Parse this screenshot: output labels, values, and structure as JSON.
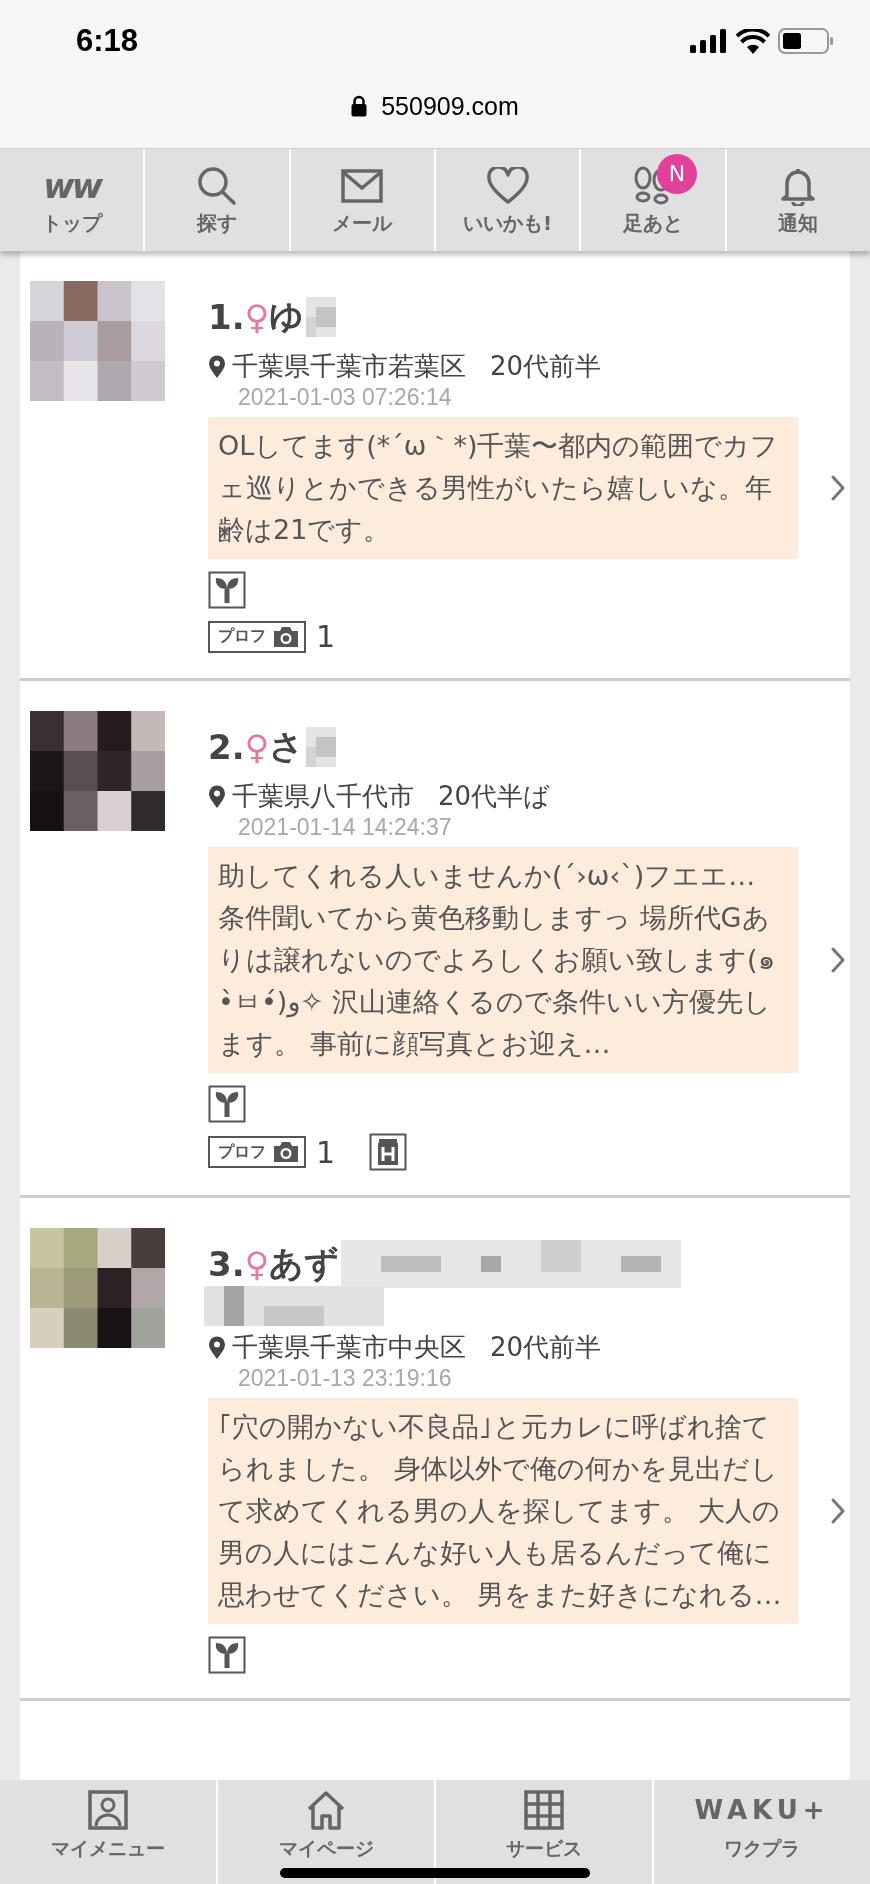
{
  "status_bar": {
    "time": "6:18"
  },
  "browser": {
    "url": "550909.com"
  },
  "nav_tabs": [
    {
      "logo": "ww",
      "label": "トップ"
    },
    {
      "label": "探す"
    },
    {
      "label": "メール"
    },
    {
      "label": "いいかも!"
    },
    {
      "label": "足あと",
      "badge": "N"
    },
    {
      "label": "通知"
    }
  ],
  "posts": [
    {
      "rank": "1.",
      "gender": "♀",
      "name": "ゆ",
      "kind": "short",
      "location": "千葉県千葉市若葉区",
      "age": "20代前半",
      "date": "2021-01-03 07:26:14",
      "message": "OLしてます(*´ω｀*)千葉〜都内の範囲でカフェ巡りとかできる男性がいたら嬉しいな。年齢は21です。",
      "beginner": true,
      "photo_badge": {
        "label": "プロフ",
        "count": "1"
      },
      "hotel": false
    },
    {
      "rank": "2.",
      "gender": "♀",
      "name": "さ",
      "kind": "short",
      "location": "千葉県八千代市",
      "age": "20代半ば",
      "date": "2021-01-14 14:24:37",
      "message": "助してくれる人いませんか(´›ω‹`)フエエ… 条件聞いてから黄色移動しますっ 場所代Gありは譲れないのでよろしくお願い致します(๑•̀ㅂ•́)و✧ 沢山連絡くるので条件いい方優先します。 事前に顔写真とお迎え…",
      "beginner": true,
      "photo_badge": {
        "label": "プロフ",
        "count": "1"
      },
      "hotel": true
    },
    {
      "rank": "3.",
      "gender": "♀",
      "name": "あず",
      "kind": "long",
      "location": "千葉県千葉市中央区",
      "age": "20代前半",
      "date": "2021-01-13 23:19:16",
      "message": "｢穴の開かない不良品｣と元カレに呼ばれ捨てられました。 身体以外で俺の何かを見出だして求めてくれる男の人を探してます。 大人の男の人にはこんな好い人も居るんだって俺に思わせてください。 男をまた好きになれる…",
      "beginner": true,
      "hotel": false
    }
  ],
  "bottom_tabs": [
    {
      "label": "マイメニュー"
    },
    {
      "label": "マイページ"
    },
    {
      "label": "サービス"
    },
    {
      "logo": "WAKU+",
      "label": "ワクプラ"
    }
  ]
}
